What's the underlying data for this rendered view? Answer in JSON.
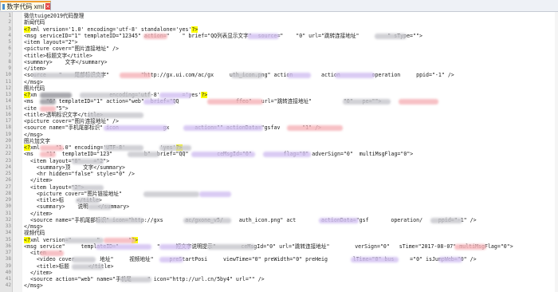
{
  "tab": {
    "icon": "file-icon",
    "label": "数字代码 xml",
    "close_icon": "close-icon"
  },
  "lines": [
    {
      "n": "1",
      "t": "微信tuige2019代码整理"
    },
    {
      "n": "2",
      "t": "新闻代码"
    },
    {
      "n": "3",
      "t": "<?xml version='1.0' encoding='utf-8' standalone='yes'?>"
    },
    {
      "n": "4",
      "t": "<msg serviceID=\"1\" templateID=\"12345\" action=\"    \" brief=\"QQ列表显示文字\"  source=\"    \"0\" url=\"跳转连接地址\"         \" sType=\"\">"
    },
    {
      "n": "5",
      "t": "<item layout=\"2\">"
    },
    {
      "n": "6",
      "t": "<picture cover=\"图片连接地址\" />"
    },
    {
      "n": "7",
      "t": "<title>标题文字</title>"
    },
    {
      "n": "8",
      "t": "<summary>    文字</summary>"
    },
    {
      "n": "9",
      "t": "</item>"
    },
    {
      "n": "10",
      "t": "<source    \"    尾部标识文字\"          \"http://gx.ui.com/ac/gx     uth_icon.png\" action         action          operation     ppid=\"-1\" />"
    },
    {
      "n": "11",
      "t": "</msg>"
    },
    {
      "n": "12",
      "t": "图片代码"
    },
    {
      "n": "13",
      "t": "<?xm                       encoding='utf-8'       ='yes'?>"
    },
    {
      "n": "14",
      "t": "<ms    \"6\" templateID=\"1\" action=\"web\"  brief=\"QQ                  ffeo\"   url=\"跳转连接地址\"          \"0\"   pe=\"\">"
    },
    {
      "n": "15",
      "t": "<ite      \"5\">"
    },
    {
      "n": "16",
      "t": "<title>透明标识文字</title>"
    },
    {
      "n": "17",
      "t": "<picture cover=\"图片连接地址\" />"
    },
    {
      "n": "18",
      "t": "<source name=\"手机尾部标识\" icon              gx        action=\"\" actionData=\"gsfav       \"1\" />"
    },
    {
      "n": "19",
      "t": "</msg>"
    },
    {
      "n": "20",
      "t": "图片加文字"
    },
    {
      "n": "21",
      "t": "<?xml     \"1.0\" encoding='UTF-8'           'yes'?>"
    },
    {
      "n": "22",
      "t": "<ms    \"1\"  templateID=\"123\"          b\"  brief=\"QQ\"         ceMsgId=\"0\"          flag=\"0\" adverSign=\"0\"  multiMsgFlag=\"0\">"
    },
    {
      "n": "23",
      "t": "  <item layout=\"0\"    =\"2\">"
    },
    {
      "n": "24",
      "t": "    <summary>顶    文字</summary>"
    },
    {
      "n": "25",
      "t": "    <hr hidden=\"false\" style=\"0\" />"
    },
    {
      "n": "26",
      "t": "  </item>"
    },
    {
      "n": "27",
      "t": "  <item layout=\"2\">"
    },
    {
      "n": "28",
      "t": "    <picture cover=\"图片链接地址\"  "
    },
    {
      "n": "29",
      "t": "    <title>标    </title>"
    },
    {
      "n": "30",
      "t": "    <summary>    说明   </summary>"
    },
    {
      "n": "31",
      "t": "  </item>"
    },
    {
      "n": "32",
      "t": "  <source name=\"手机尾部标识\" icon=\"http://gxs       ac/gxone_v5/     auth_icon.png\" act        actionData=\"gsf       operation/     ppid=\"-1\" />"
    },
    {
      "n": "33",
      "t": "</msg>"
    },
    {
      "n": "34",
      "t": "视频代码"
    },
    {
      "n": "35",
      "t": "<?xml version=\"        \"         \"?>"
    },
    {
      "n": "36",
      "t": "<msg service\"     templateID=\"            \"     短文字说明提示\"        ceMsgId=\"0\" url=\"跳转连接地址\"        verSign=\"0\"   sTime=\"2017-08-07\" multiMsgFlag=\"0\">"
    },
    {
      "n": "37",
      "t": "  <item    \"  "
    },
    {
      "n": "38",
      "t": "    <video cover        地址\"     视频地址\"     preStartPosi     viewTime=\"0\" preWidth=\"0\" preHeig        lTime=\"0\" bus     =\"0\" isJumpWeb=\"0\" />"
    },
    {
      "n": "39",
      "t": "    <title>标题      </title>"
    },
    {
      "n": "40",
      "t": "  </item>"
    },
    {
      "n": "41",
      "t": "  <source action=\"web\" name=\"手机尾     \" icon=\"http://url.cn/5by4\" url=\"\" />"
    },
    {
      "n": "42",
      "t": "</msg>"
    }
  ]
}
